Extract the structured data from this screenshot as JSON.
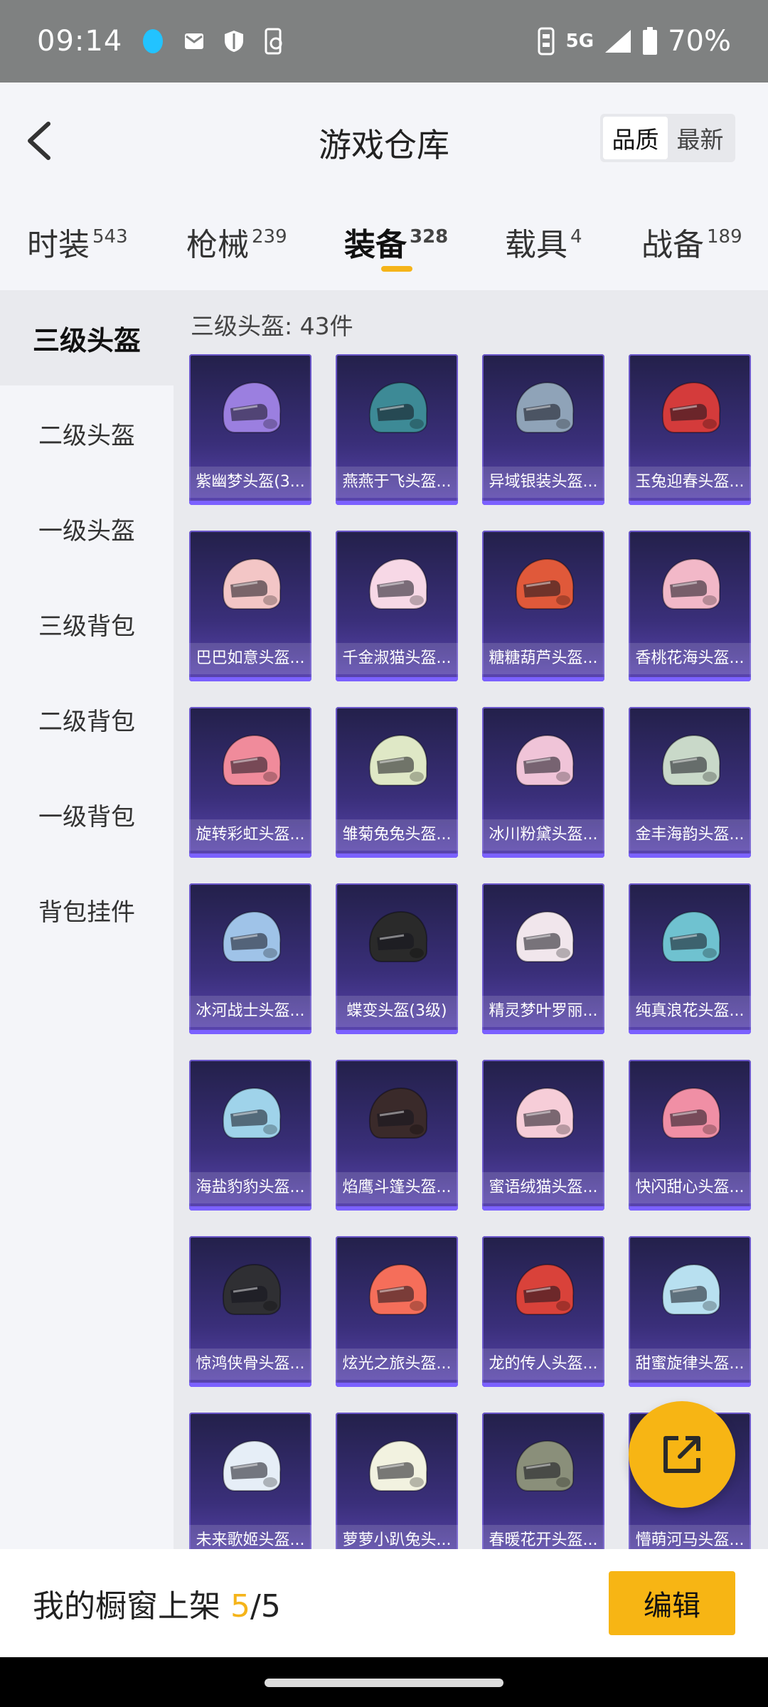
{
  "status_bar": {
    "time": "09:14",
    "network": "5G",
    "battery": "70%"
  },
  "header": {
    "title": "游戏仓库",
    "sort_options": [
      "品质",
      "最新"
    ],
    "sort_selected": "品质"
  },
  "tabs": [
    {
      "label": "时装",
      "count": "543"
    },
    {
      "label": "枪械",
      "count": "239"
    },
    {
      "label": "装备",
      "count": "328"
    },
    {
      "label": "载具",
      "count": "4"
    },
    {
      "label": "战备",
      "count": "189"
    }
  ],
  "active_tab": "装备",
  "sidebar": {
    "items": [
      "三级头盔",
      "二级头盔",
      "一级头盔",
      "三级背包",
      "二级背包",
      "一级背包",
      "背包挂件"
    ],
    "active": "三级头盔"
  },
  "list": {
    "count_label": "三级头盔: 43件",
    "items": [
      {
        "name": "紫幽梦头盔(3...",
        "color": "#9b7fe0"
      },
      {
        "name": "燕燕于飞头盔...",
        "color": "#3d8a96"
      },
      {
        "name": "异域银装头盔...",
        "color": "#8fa3b8"
      },
      {
        "name": "玉兔迎春头盔...",
        "color": "#d43b3b"
      },
      {
        "name": "巴巴如意头盔...",
        "color": "#f3c6c6"
      },
      {
        "name": "千金淑猫头盔...",
        "color": "#f7d8e6"
      },
      {
        "name": "糖糖葫芦头盔...",
        "color": "#e0593a"
      },
      {
        "name": "香桃花海头盔...",
        "color": "#f2b8c8"
      },
      {
        "name": "旋转彩虹头盔...",
        "color": "#f08b9b"
      },
      {
        "name": "雏菊兔兔头盔...",
        "color": "#dfe8c6"
      },
      {
        "name": "冰川粉黛头盔...",
        "color": "#f0c4d8"
      },
      {
        "name": "金丰海韵头盔...",
        "color": "#c9d9c9"
      },
      {
        "name": "冰河战士头盔...",
        "color": "#9fc3e8"
      },
      {
        "name": "蝶变头盔(3级)",
        "color": "#2a2a2a"
      },
      {
        "name": "精灵梦叶罗丽...",
        "color": "#f1e6ec"
      },
      {
        "name": "纯真浪花头盔...",
        "color": "#6fc2d0"
      },
      {
        "name": "海盐豹豹头盔...",
        "color": "#9fd3ea"
      },
      {
        "name": "焰鹰斗篷头盔...",
        "color": "#3a2a2a"
      },
      {
        "name": "蜜语绒猫头盔...",
        "color": "#f6cdd8"
      },
      {
        "name": "快闪甜心头盔...",
        "color": "#f08fa5"
      },
      {
        "name": "惊鸿侠骨头盔...",
        "color": "#2f2f33"
      },
      {
        "name": "炫光之旅头盔...",
        "color": "#f56e5a"
      },
      {
        "name": "龙的传人头盔...",
        "color": "#d9423a"
      },
      {
        "name": "甜蜜旋律头盔...",
        "color": "#b8e0f0"
      },
      {
        "name": "未来歌姬头盔...",
        "color": "#e6eef7"
      },
      {
        "name": "萝萝小趴兔头...",
        "color": "#f2f2e0"
      },
      {
        "name": "春暖花开头盔...",
        "color": "#8a8f7a"
      },
      {
        "name": "懵萌河马头盔...",
        "color": "#d8a060"
      }
    ]
  },
  "bottom_bar": {
    "shelf_label": "我的橱窗上架",
    "shelf_current": "5",
    "shelf_total": "/5",
    "edit_label": "编辑"
  },
  "colors": {
    "accent": "#f7b514",
    "card_border": "#6a56c9"
  },
  "icons": {
    "back": "chevron-left-icon",
    "fab": "share-external-icon"
  }
}
